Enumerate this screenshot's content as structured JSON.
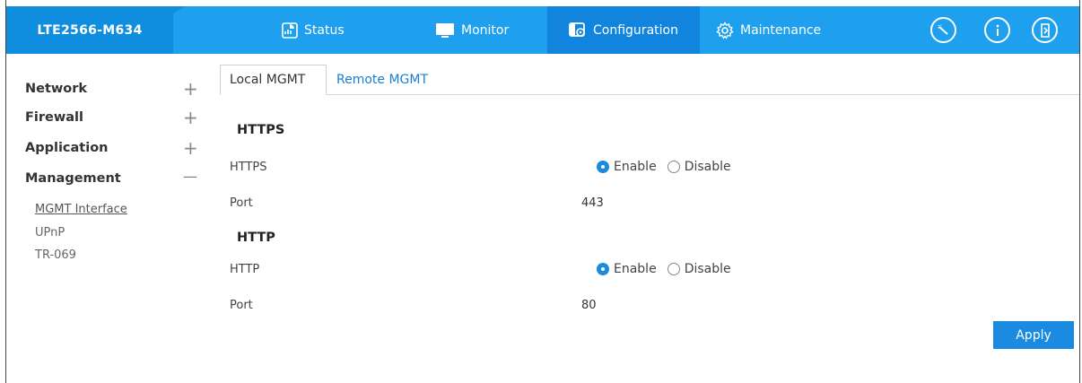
{
  "brand": {
    "name": "LTE2566-M634"
  },
  "nav": {
    "status": {
      "label": "Status",
      "icon": "status-chart-icon"
    },
    "monitor": {
      "label": "Monitor",
      "icon": "monitor-icon"
    },
    "configuration": {
      "label": "Configuration",
      "icon": "configuration-icon",
      "active": true
    },
    "maintenance": {
      "label": "Maintenance",
      "icon": "gear-icon"
    }
  },
  "header_icons": [
    "wizard-icon",
    "info-icon",
    "logout-icon"
  ],
  "sidebar": {
    "items": [
      {
        "label": "Network",
        "toggle": "+"
      },
      {
        "label": "Firewall",
        "toggle": "+"
      },
      {
        "label": "Application",
        "toggle": "+"
      },
      {
        "label": "Management",
        "toggle": "—"
      }
    ],
    "subitems": [
      {
        "label": "MGMT Interface",
        "current": true
      },
      {
        "label": "UPnP"
      },
      {
        "label": "TR-069"
      }
    ]
  },
  "tabs": [
    {
      "label": "Local MGMT",
      "active": true
    },
    {
      "label": "Remote MGMT"
    }
  ],
  "sections": {
    "https": {
      "title": "HTTPS",
      "row1_label": "HTTPS",
      "enable_label": "Enable",
      "disable_label": "Disable",
      "selected": "Enable",
      "port_label": "Port",
      "port_value": "443"
    },
    "http": {
      "title": "HTTP",
      "row1_label": "HTTP",
      "enable_label": "Enable",
      "disable_label": "Disable",
      "selected": "Enable",
      "port_label": "Port",
      "port_value": "80"
    }
  },
  "apply_label": "Apply",
  "colors": {
    "topbar": "#1ea0ef",
    "brand_bg": "#0f8ee0",
    "accent": "#1a8be0"
  }
}
